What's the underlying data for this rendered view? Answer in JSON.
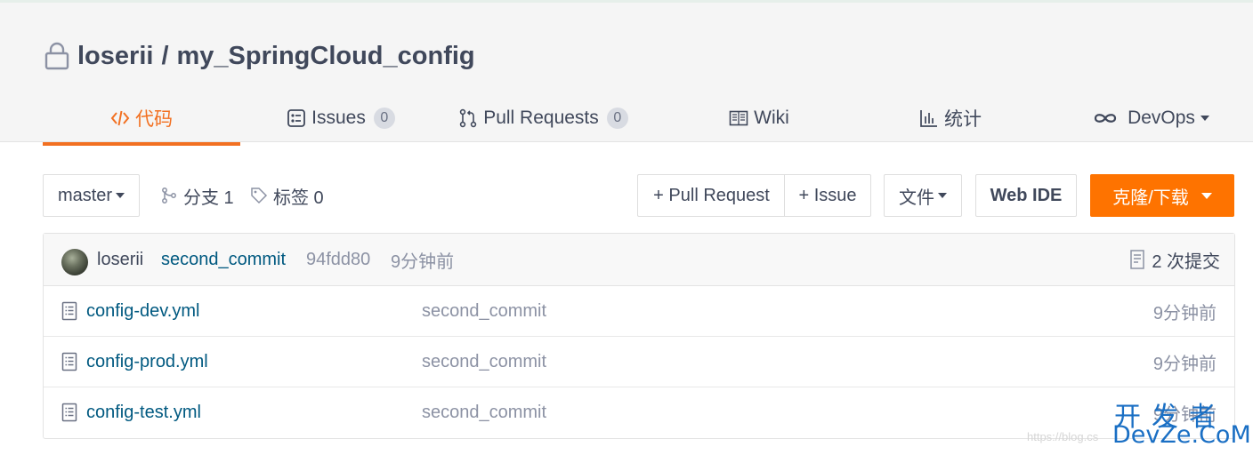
{
  "repo": {
    "owner": "loserii",
    "separator": "/",
    "name": "my_SpringCloud_config"
  },
  "tabs": [
    {
      "label": "代码",
      "icon": "code-icon",
      "active": true
    },
    {
      "label": "Issues",
      "icon": "issues-icon",
      "badge": "0"
    },
    {
      "label": "Pull Requests",
      "icon": "pull-request-icon",
      "badge": "0"
    },
    {
      "label": "Wiki",
      "icon": "wiki-book-icon"
    },
    {
      "label": "统计",
      "icon": "stats-chart-icon"
    },
    {
      "label": "DevOps",
      "icon": "infinity-icon",
      "dropdown": true
    }
  ],
  "toolbar": {
    "branch": "master",
    "branches_label": "分支 1",
    "tags_label": "标签 0",
    "new_pr_label": "+ Pull Request",
    "new_issue_label": "+ Issue",
    "file_menu_label": "文件",
    "web_ide_label": "Web IDE",
    "clone_label": "克隆/下载"
  },
  "last_commit": {
    "author": "loserii",
    "message": "second_commit",
    "sha": "94fdd80",
    "time": "9分钟前",
    "count_label": "2 次提交"
  },
  "files": [
    {
      "name": "config-dev.yml",
      "message": "second_commit",
      "time": "9分钟前"
    },
    {
      "name": "config-prod.yml",
      "message": "second_commit",
      "time": "9分钟前"
    },
    {
      "name": "config-test.yml",
      "message": "second_commit",
      "time": "9分钟前"
    }
  ],
  "watermark": {
    "line1": "开发者",
    "line2": "DevZe.CoM",
    "url": "https://blog.cs"
  },
  "colors": {
    "accent": "#f27021",
    "clone_button": "#fe7300",
    "link": "#005980",
    "muted": "#8c92a4"
  }
}
